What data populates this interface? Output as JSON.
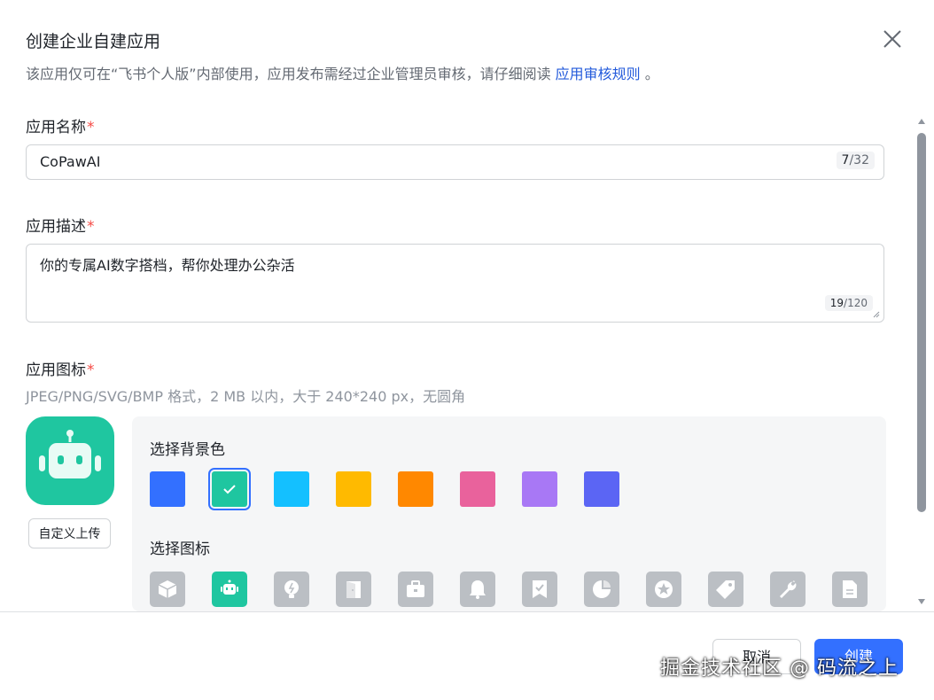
{
  "dialog": {
    "title": "创建企业自建应用",
    "subtitle_prefix": "该应用仅可在“飞书个人版”内部使用，应用发布需经过企业管理员审核，请仔细阅读 ",
    "subtitle_link": "应用审核规则",
    "subtitle_suffix": " 。",
    "close_icon": "close-icon"
  },
  "form": {
    "name": {
      "label": "应用名称",
      "required_mark": "*",
      "value": "CoPawAI",
      "count_current": "7",
      "count_max": "/32"
    },
    "description": {
      "label": "应用描述",
      "required_mark": "*",
      "value": "你的专属AI数字搭档，帮你处理办公杂活",
      "count_current": "19",
      "count_max": "/120"
    },
    "icon": {
      "label": "应用图标",
      "required_mark": "*",
      "hint": "JPEG/PNG/SVG/BMP 格式，2 MB 以内，大于 240*240 px，无圆角",
      "preview_icon": "robot-icon",
      "upload_label": "自定义上传"
    }
  },
  "picker": {
    "bg_title": "选择背景色",
    "icon_title": "选择图标",
    "colors": [
      "#3370ff",
      "#1fc6a0",
      "#14c0ff",
      "#ffba00",
      "#ff8800",
      "#e9629c",
      "#a878f5",
      "#5b65f4"
    ],
    "selected_color_index": 1,
    "icons": [
      "cube-icon",
      "robot-icon",
      "lightbulb-icon",
      "door-icon",
      "briefcase-icon",
      "bell-icon",
      "bookmark-check-icon",
      "pie-chart-icon",
      "star-badge-icon",
      "tag-icon",
      "wrench-icon",
      "document-icon"
    ],
    "selected_icon_index": 1
  },
  "footer": {
    "cancel_label": "取消",
    "create_label": "创建"
  },
  "watermark": "掘金技术社区 @ 码流之上"
}
